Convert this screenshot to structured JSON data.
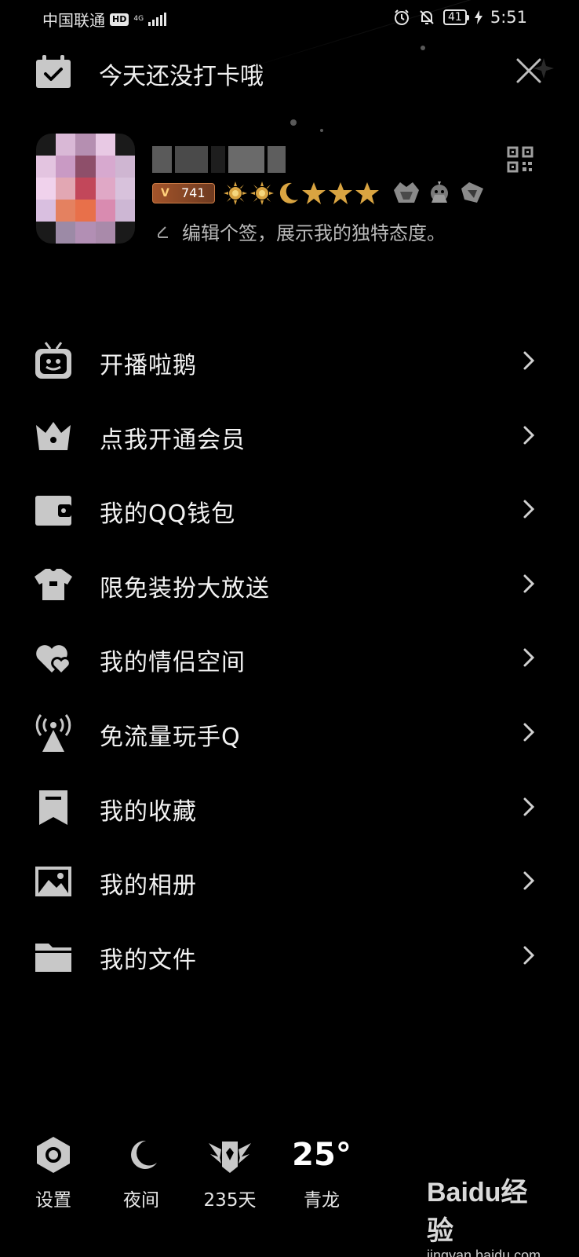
{
  "status_bar": {
    "carrier": "中国联通",
    "hd": "HD",
    "network": "4G",
    "battery": "41",
    "time": "5:51"
  },
  "header": {
    "checkin_text": "今天还没打卡哦"
  },
  "profile": {
    "level": "741",
    "signature": "编辑个签，展示我的独特态度。"
  },
  "menu": [
    {
      "label": "开播啦鹅",
      "icon": "tv-mascot-icon"
    },
    {
      "label": "点我开通会员",
      "icon": "crown-icon"
    },
    {
      "label": "我的QQ钱包",
      "icon": "wallet-icon"
    },
    {
      "label": "限免装扮大放送",
      "icon": "tshirt-icon"
    },
    {
      "label": "我的情侣空间",
      "icon": "hearts-icon"
    },
    {
      "label": "免流量玩手Q",
      "icon": "signal-tower-icon"
    },
    {
      "label": "我的收藏",
      "icon": "bookmark-icon"
    },
    {
      "label": "我的相册",
      "icon": "photo-icon"
    },
    {
      "label": "我的文件",
      "icon": "folder-icon"
    }
  ],
  "bottom_bar": {
    "settings_label": "设置",
    "night_label": "夜间",
    "days_label": "235天",
    "temperature": "25°",
    "location": "青龙"
  },
  "watermark": {
    "logo": "Baidu经验",
    "url": "jingyan.baidu.com"
  },
  "colors": {
    "background": "#000000",
    "text": "#f2f2f2",
    "icon_gray": "#c8c8c8",
    "level_badge": "#a3542a",
    "crown_gold": "#d9a441"
  }
}
